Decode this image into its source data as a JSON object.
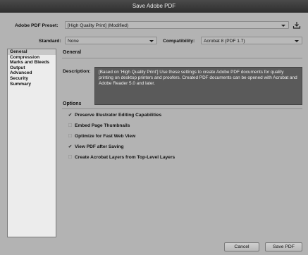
{
  "window": {
    "title": "Save Adobe PDF"
  },
  "preset": {
    "label": "Adobe PDF Preset:",
    "value": "[High Quality Print] (Modified)"
  },
  "standard": {
    "label": "Standard:",
    "value": "None"
  },
  "compatibility": {
    "label": "Compatibility:",
    "value": "Acrobat 8 (PDF 1.7)"
  },
  "sidebar": {
    "items": [
      {
        "label": "General",
        "selected": true
      },
      {
        "label": "Compression"
      },
      {
        "label": "Marks and Bleeds"
      },
      {
        "label": "Output"
      },
      {
        "label": "Advanced"
      },
      {
        "label": "Security"
      },
      {
        "label": "Summary"
      }
    ]
  },
  "main": {
    "section_title": "General",
    "description_label": "Description:",
    "description_text": "[Based on 'High Quality Print'] Use these settings to create Adobe PDF documents for quality printing on desktop printers and proofers.  Created PDF documents can be opened with Acrobat and Adobe Reader 5.0 and later.",
    "options_title": "Options",
    "options": [
      {
        "label": "Preserve Illustrator Editing Capabilities",
        "checked": true
      },
      {
        "label": "Embed Page Thumbnails",
        "checked": false
      },
      {
        "label": "Optimize for Fast Web View",
        "checked": false
      },
      {
        "label": "View PDF after Saving",
        "checked": true
      },
      {
        "label": "Create Acrobat Layers from Top-Level Layers",
        "checked": false
      }
    ]
  },
  "buttons": {
    "cancel": "Cancel",
    "save": "Save PDF"
  },
  "icons": {
    "checkmark": "✔",
    "unchecked": "☐",
    "save_preset": "save-preset-icon"
  }
}
